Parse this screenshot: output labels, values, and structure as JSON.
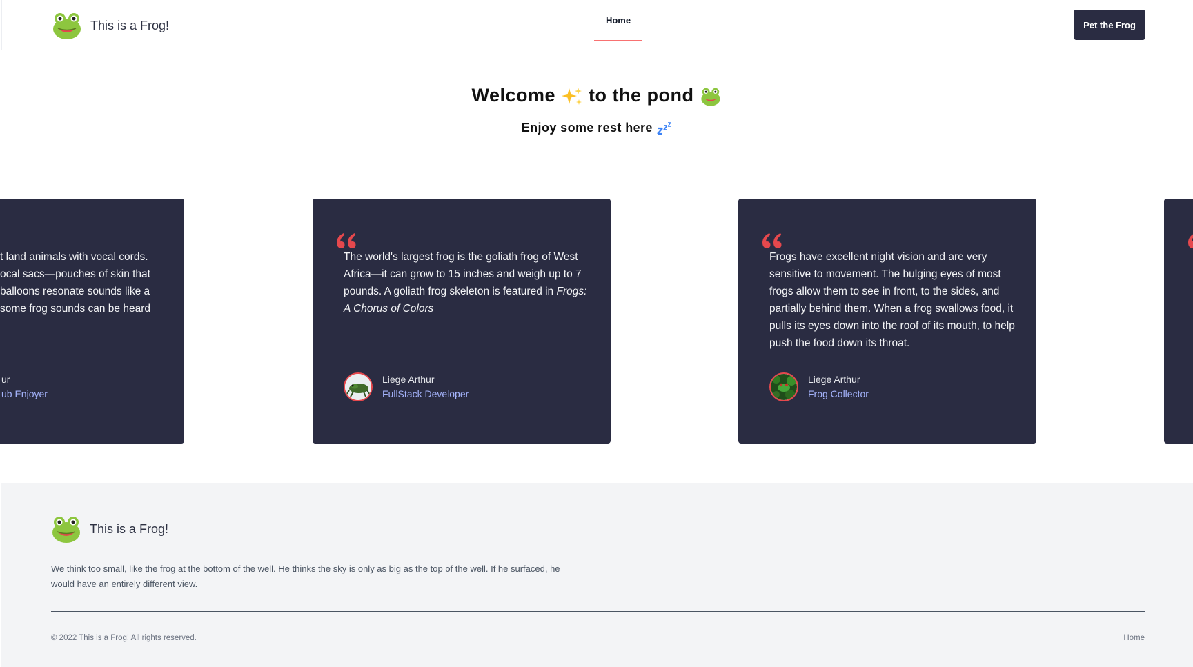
{
  "header": {
    "brand": "This is a Frog!",
    "nav_home": "Home",
    "cta": "Pet the Frog"
  },
  "hero": {
    "title_part1": "Welcome",
    "title_part2": "to the pond",
    "subtitle": "Enjoy some rest here",
    "icons": [
      "sparkles-icon",
      "frog-icon",
      "zzz-icon"
    ]
  },
  "cards": [
    {
      "lines": [
        "t land animals with vocal cords.",
        "ocal sacs—pouches of skin that",
        "balloons resonate sounds like a",
        "some frog sounds can be heard"
      ],
      "name_partial": "ur",
      "role_partial": "ub Enjoyer"
    },
    {
      "text": "The world's largest frog is the goliath frog of West Africa—it can grow to 15 inches and weigh up to 7 pounds. A goliath frog skeleton is featured in ",
      "text_italic": "Frogs: A Chorus of Colors",
      "name": "Liege Arthur",
      "role": "FullStack Developer"
    },
    {
      "text": "Frogs have excellent night vision and are very sensitive to movement. The bulging eyes of most frogs allow them to see in front, to the sides, and partially behind them. When a frog swallows food, it pulls its eyes down into the roof of its mouth, to help push the food down its throat.",
      "name": "Liege Arthur",
      "role": "Frog Collector"
    }
  ],
  "footer": {
    "brand": "This is a Frog!",
    "description": "We think too small, like the frog at the bottom of the well. He thinks the sky is only as big as the top of the well. If he surfaced, he would have an entirely different view.",
    "copyright": "© 2022 This is a Frog! All rights reserved.",
    "home_link": "Home"
  },
  "colors": {
    "card_bg": "#2a2c42",
    "accent_red": "#e5484d",
    "role_text": "#a5b4fc",
    "footer_bg": "#f3f4f6"
  }
}
